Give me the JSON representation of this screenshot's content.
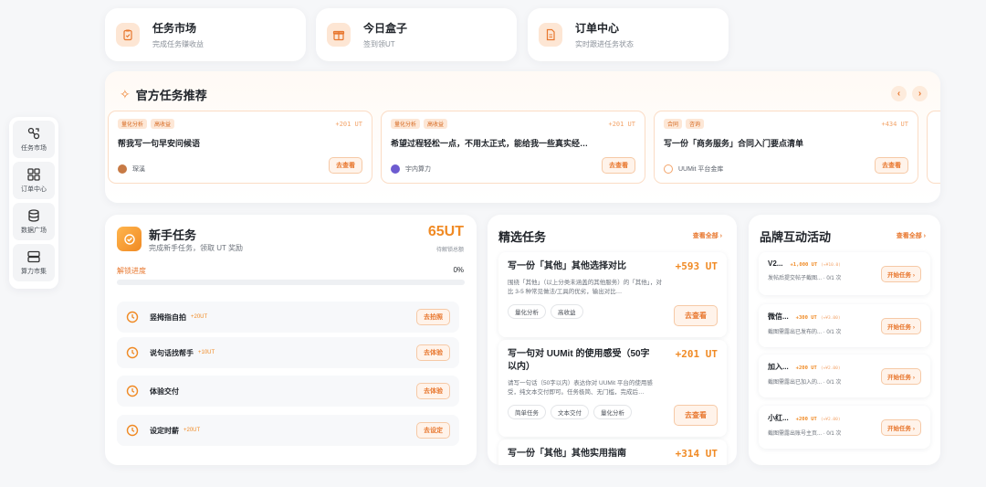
{
  "colors": {
    "accent": "#f08a24",
    "accent_light": "#fde6d4",
    "bg": "#f6f7f9"
  },
  "sidenav": [
    {
      "label": "任务市场",
      "icon": "chain-icon"
    },
    {
      "label": "订单中心",
      "icon": "grid-icon"
    },
    {
      "label": "数据广场",
      "icon": "database-icon"
    },
    {
      "label": "算力市集",
      "icon": "server-icon"
    }
  ],
  "quick": [
    {
      "title": "任务市场",
      "sub": "完成任务赚收益",
      "icon": "clipboard-icon"
    },
    {
      "title": "今日盒子",
      "sub": "签到领UT",
      "icon": "gift-icon"
    },
    {
      "title": "订单中心",
      "sub": "实时跟进任务状态",
      "icon": "document-icon"
    }
  ],
  "official": {
    "title": "官方任务推荐",
    "cards": [
      {
        "tags": [
          "量化分析",
          "高收益"
        ],
        "reward": "+201 UT",
        "title": "帮我写一句早安问候语",
        "author": "琛溪",
        "button": "去查看"
      },
      {
        "tags": [
          "量化分析",
          "高收益"
        ],
        "reward": "+201 UT",
        "title": "希望过程轻松一点，不用太正式，能给我一些真实经…",
        "author": "宇内算力",
        "button": "去查看"
      },
      {
        "tags": [
          "合同",
          "咨询"
        ],
        "reward": "+434 UT",
        "title": "写一份「商务服务」合同入门要点清单",
        "author": "UUMit 平台金库",
        "button": "去查看"
      }
    ]
  },
  "newbie": {
    "title": "新手任务",
    "sub": "完成新手任务，领取 UT 奖励",
    "ut": "65UT",
    "ut_label": "待解锁总额",
    "unlock_label": "解锁进度",
    "progress_text": "0%",
    "progress": 0,
    "tasks": [
      {
        "name": "竖拇指自拍",
        "reward": "+20UT",
        "button": "去拍照"
      },
      {
        "name": "说句话找帮手",
        "reward": "+10UT",
        "button": "去体验"
      },
      {
        "name": "体验交付",
        "reward": "",
        "button": "去体验"
      },
      {
        "name": "设定时薪",
        "reward": "+20UT",
        "button": "去设定"
      }
    ]
  },
  "featured": {
    "title": "精选任务",
    "see_all": "查看全部 ›",
    "items": [
      {
        "title": "写一份「其他」其他选择对比",
        "reward": "+593 UT",
        "desc": "围绕「其他」（以上分类未涵盖的其他服务）的「其他」，对比 3-5 种常见做法/工具的优劣，输出对比…",
        "tags": [
          "量化分析",
          "高收益"
        ],
        "button": "去查看"
      },
      {
        "title": "写一句对 UUMit 的使用感受（50字以内）",
        "reward": "+201 UT",
        "desc": "请写一句话（50字以内）表达你对 UUMit 平台的使用感受，纯文本交付即可。任务极简、无门槛，完成后…",
        "tags": [
          "简单任务",
          "文本交付",
          "量化分析"
        ],
        "button": "去查看"
      },
      {
        "title": "写一份「其他」其他实用指南",
        "reward": "+314 UT"
      }
    ]
  },
  "brand": {
    "title": "品牌互动活动",
    "see_all": "查看全部 ›",
    "items": [
      {
        "name": "V2...",
        "reward": "+1,000 UT",
        "approx": "(≈¥10.0)",
        "desc": "发帖后提交帖子截图...",
        "count": "· 0/1 次",
        "button": "开始任务 ›"
      },
      {
        "name": "微信...",
        "reward": "+300 UT",
        "approx": "(≈¥3.00)",
        "desc": "截图需露出已发布的...",
        "count": "· 0/1 次",
        "button": "开始任务 ›"
      },
      {
        "name": "加入...",
        "reward": "+200 UT",
        "approx": "(≈¥2.00)",
        "desc": "截图需露出已加入的...",
        "count": "· 0/1 次",
        "button": "开始任务 ›"
      },
      {
        "name": "小红...",
        "reward": "+200 UT",
        "approx": "(≈¥2.00)",
        "desc": "截图需露出账号主页...",
        "count": "· 0/1 次",
        "button": "开始任务 ›"
      }
    ]
  }
}
